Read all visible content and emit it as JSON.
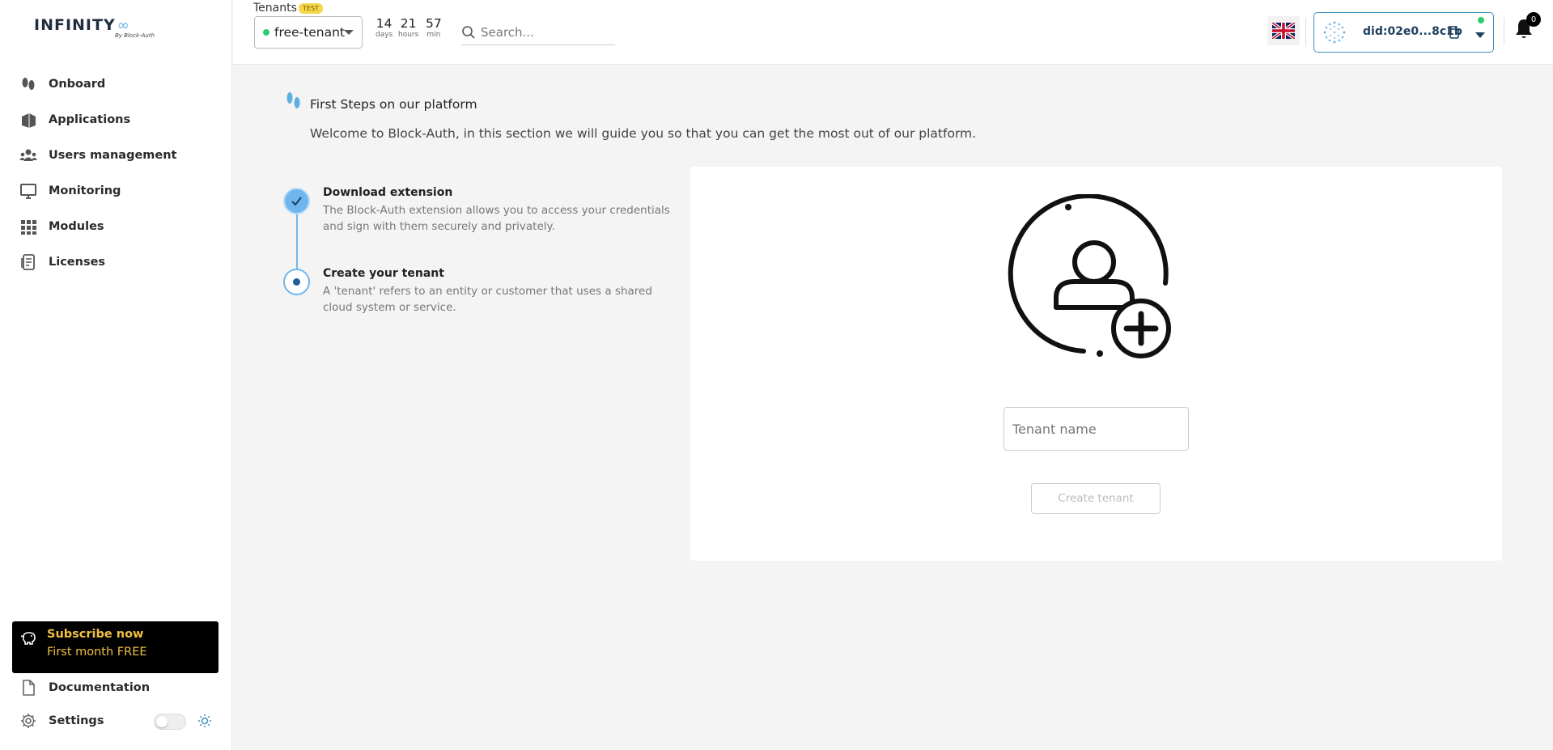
{
  "brand": {
    "name": "INFINITY",
    "symbol": "∞",
    "tagline": "By Block-Auth"
  },
  "sidebar": {
    "items": [
      {
        "label": "Onboard",
        "icon": "footsteps-icon"
      },
      {
        "label": "Applications",
        "icon": "applications-icon"
      },
      {
        "label": "Users management",
        "icon": "users-icon"
      },
      {
        "label": "Monitoring",
        "icon": "monitor-icon"
      },
      {
        "label": "Modules",
        "icon": "grid-icon"
      },
      {
        "label": "Licenses",
        "icon": "license-icon"
      }
    ],
    "subscribe": {
      "title": "Subscribe now",
      "subtitle": "First month FREE"
    },
    "documentation": "Documentation",
    "settings": "Settings"
  },
  "topbar": {
    "tenants_label": "Tenants",
    "test_badge": "TEST",
    "tenant_value": "free-tenant",
    "timer": [
      {
        "num": "14",
        "unit": "days"
      },
      {
        "num": "21",
        "unit": "hours"
      },
      {
        "num": "57",
        "unit": "min"
      }
    ],
    "search_placeholder": "Search...",
    "language": "en-GB",
    "did": "did:02e0...8c1b",
    "notifications": "0"
  },
  "main": {
    "title": "First Steps on our platform",
    "subtitle": "Welcome to Block-Auth, in this section we will guide you so that you can get the most out of our platform.",
    "steps": [
      {
        "title": "Download extension",
        "desc": "The Block-Auth extension allows you to access your credentials and sign with them securely and privately.",
        "status": "done"
      },
      {
        "title": "Create your tenant",
        "desc": "A 'tenant' refers to an entity or customer that uses a shared cloud system or service.",
        "status": "current"
      }
    ],
    "tenant_input_placeholder": "Tenant name",
    "create_button": "Create tenant"
  },
  "colors": {
    "accent": "#6fb6ee",
    "subscribe_text": "#f0c040",
    "online": "#2ecc71"
  }
}
